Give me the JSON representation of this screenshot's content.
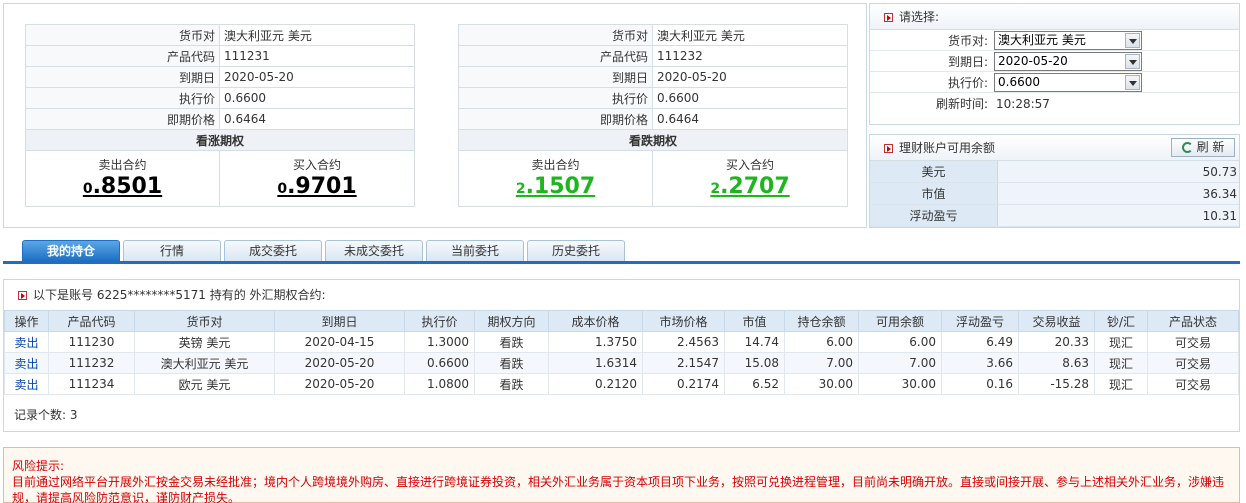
{
  "quotes": [
    {
      "rows": [
        {
          "label": "货币对",
          "value": "澳大利亚元 美元"
        },
        {
          "label": "产品代码",
          "value": "111231"
        },
        {
          "label": "到期日",
          "value": "2020-05-20"
        },
        {
          "label": "执行价",
          "value": "0.6600"
        },
        {
          "label": "即期价格",
          "value": "0.6464"
        }
      ],
      "title": "看涨期权",
      "sell_label": "卖出合约",
      "sell_int": "0",
      "sell_dec": ".8501",
      "buy_label": "买入合约",
      "buy_int": "0",
      "buy_dec": ".9701"
    },
    {
      "rows": [
        {
          "label": "货币对",
          "value": "澳大利亚元 美元"
        },
        {
          "label": "产品代码",
          "value": "111232"
        },
        {
          "label": "到期日",
          "value": "2020-05-20"
        },
        {
          "label": "执行价",
          "value": "0.6600"
        },
        {
          "label": "即期价格",
          "value": "0.6464"
        }
      ],
      "title": "看跌期权",
      "sell_label": "卖出合约",
      "sell_int": "2",
      "sell_dec": ".1507",
      "buy_label": "买入合约",
      "buy_int": "2",
      "buy_dec": ".2707"
    }
  ],
  "select_panel": {
    "header": "请选择:",
    "currency_label": "货币对:",
    "currency_value": "澳大利亚元 美元",
    "expiry_label": "到期日:",
    "expiry_value": "2020-05-20",
    "strike_label": "执行价:",
    "strike_value": "0.6600",
    "refresh_time_label": "刷新时间:",
    "refresh_time_value": "10:28:57"
  },
  "balance_panel": {
    "header": "理财账户可用余额",
    "refresh_label": "刷 新",
    "rows": [
      {
        "label": "美元",
        "value": "50.73"
      },
      {
        "label": "市值",
        "value": "36.34"
      },
      {
        "label": "浮动盈亏",
        "value": "10.31"
      }
    ]
  },
  "tabs": [
    "我的持仓",
    "行情",
    "成交委托",
    "未成交委托",
    "当前委托",
    "历史委托"
  ],
  "holdings": {
    "header": "以下是账号 6225********5171 持有的 外汇期权合约:",
    "columns": [
      "操作",
      "产品代码",
      "货币对",
      "到期日",
      "执行价",
      "期权方向",
      "成本价格",
      "市场价格",
      "市值",
      "持仓余额",
      "可用余额",
      "浮动盈亏",
      "交易收益",
      "钞/汇",
      "产品状态"
    ],
    "rows": [
      [
        "卖出",
        "111230",
        "英镑 美元",
        "2020-04-15",
        "1.3000",
        "看跌",
        "1.3750",
        "2.4563",
        "14.74",
        "6.00",
        "6.00",
        "6.49",
        "20.33",
        "现汇",
        "可交易"
      ],
      [
        "卖出",
        "111232",
        "澳大利亚元 美元",
        "2020-05-20",
        "0.6600",
        "看跌",
        "1.6314",
        "2.1547",
        "15.08",
        "7.00",
        "7.00",
        "3.66",
        "8.63",
        "现汇",
        "可交易"
      ],
      [
        "卖出",
        "111234",
        "欧元 美元",
        "2020-05-20",
        "1.0800",
        "看跌",
        "0.2120",
        "0.2174",
        "6.52",
        "30.00",
        "30.00",
        "0.16",
        "-15.28",
        "现汇",
        "可交易"
      ]
    ],
    "record_count": "记录个数: 3"
  },
  "risk": {
    "title": "风险提示:",
    "text": "目前通过网络平台开展外汇按金交易未经批准；境内个人跨境境外购房、直接进行跨境证券投资，相关外汇业务属于资本项目项下业务，按照可兑换进程管理，目前尚未明确开放。直接或间接开展、参与上述相关外汇业务，涉嫌违规，请提高风险防范意识，谨防财产损失。"
  }
}
